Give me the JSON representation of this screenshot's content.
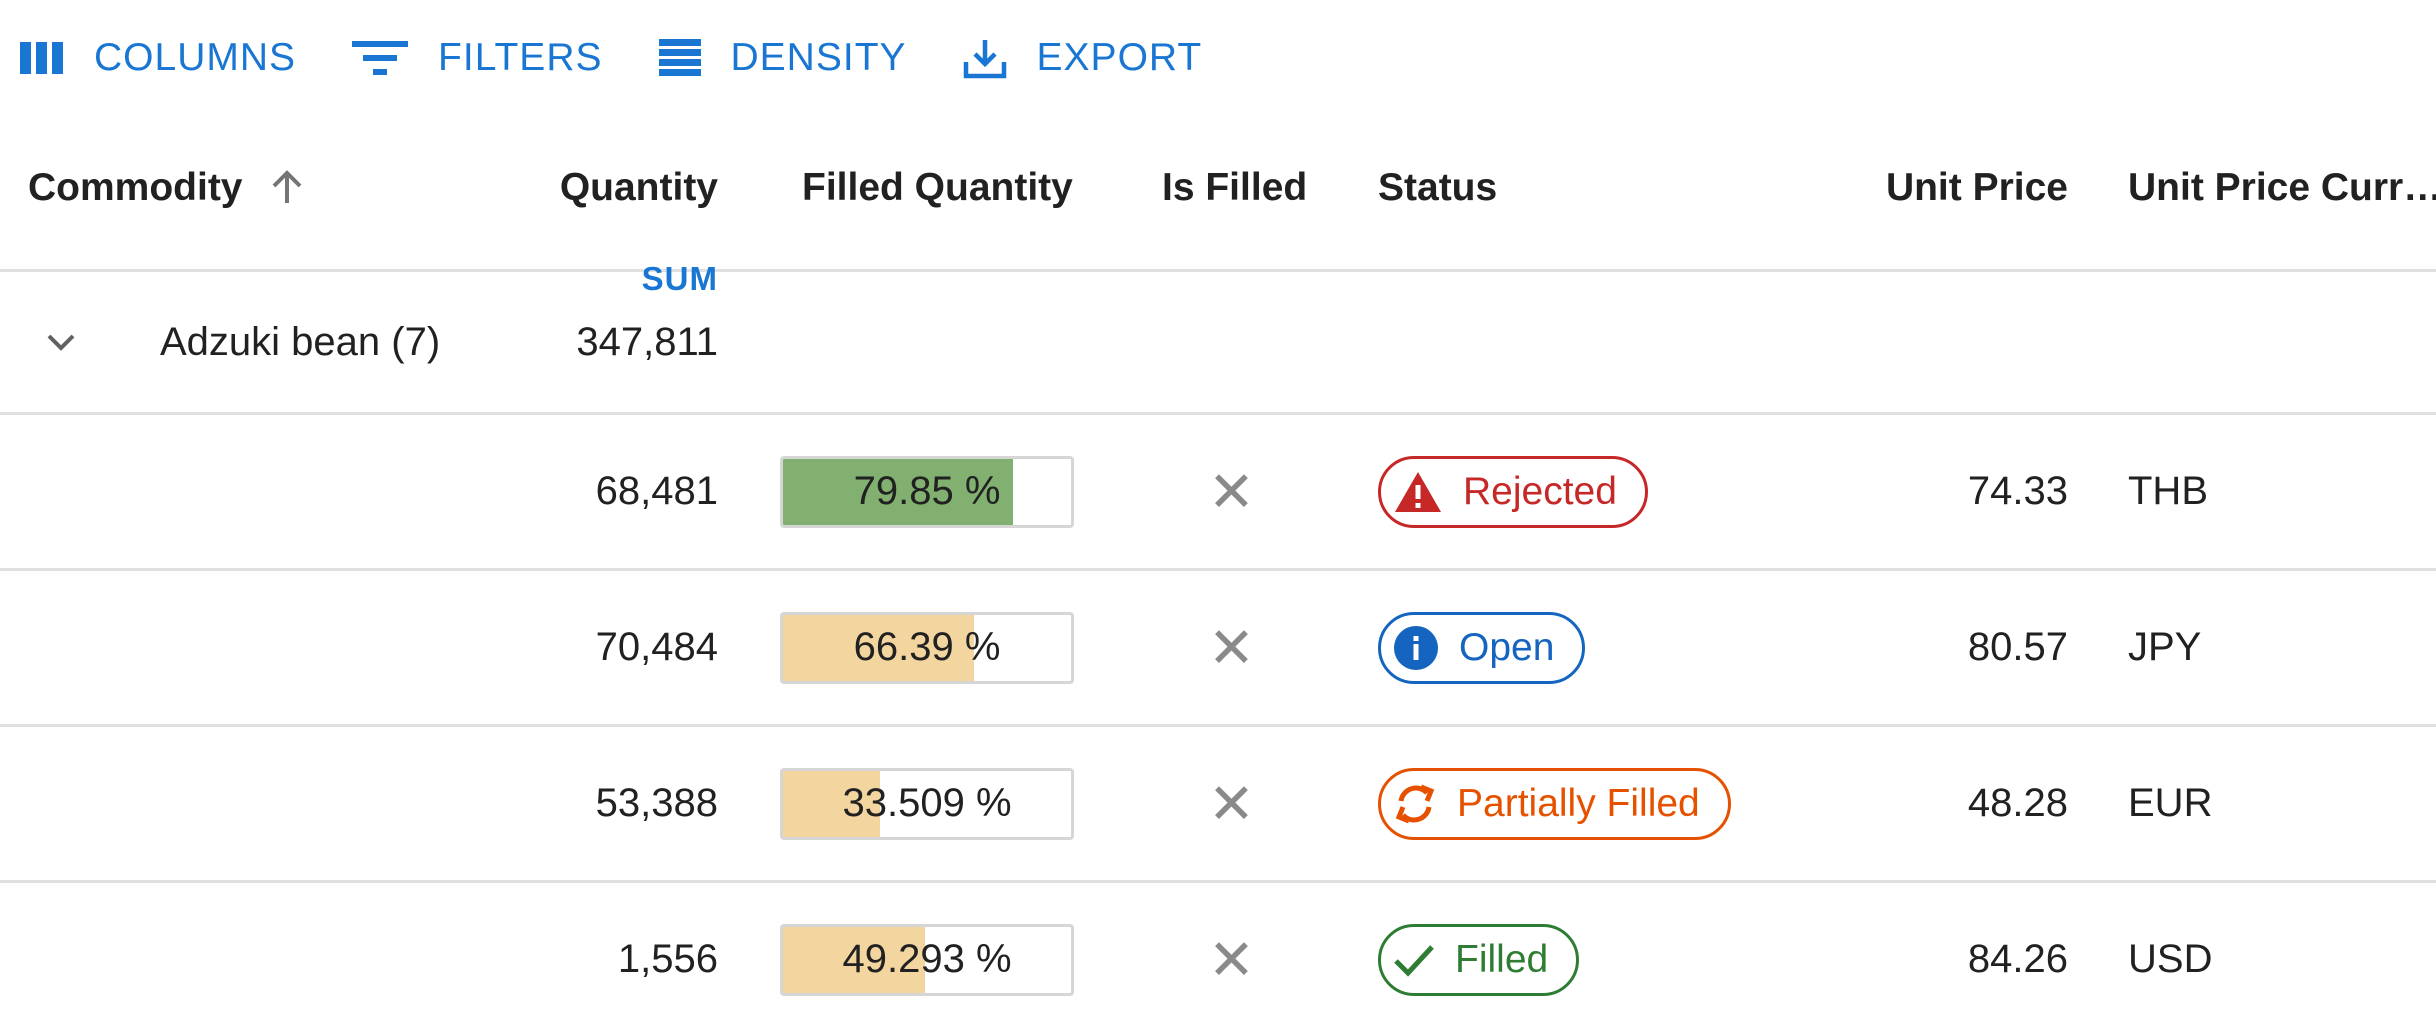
{
  "toolbar": {
    "columns_label": "COLUMNS",
    "filters_label": "FILTERS",
    "density_label": "DENSITY",
    "export_label": "EXPORT"
  },
  "columns": {
    "commodity": "Commodity",
    "quantity": "Quantity",
    "quantity_agg": "SUM",
    "filled_quantity": "Filled Quantity",
    "is_filled": "Is Filled",
    "status": "Status",
    "unit_price": "Unit Price",
    "unit_price_currency": "Unit Price Curr…"
  },
  "group": {
    "label": "Adzuki bean (7)",
    "quantity_sum": "347,811"
  },
  "rows": [
    {
      "quantity": "68,481",
      "filled_pct": 79.85,
      "filled_text": "79.85 %",
      "is_filled": "✕",
      "status": "Rejected",
      "unit_price": "74.33",
      "currency": "THB"
    },
    {
      "quantity": "70,484",
      "filled_pct": 66.39,
      "filled_text": "66.39 %",
      "is_filled": "✕",
      "status": "Open",
      "unit_price": "80.57",
      "currency": "JPY"
    },
    {
      "quantity": "53,388",
      "filled_pct": 33.509,
      "filled_text": "33.509 %",
      "is_filled": "✕",
      "status": "Partially Filled",
      "unit_price": "48.28",
      "currency": "EUR"
    },
    {
      "quantity": "1,556",
      "filled_pct": 49.293,
      "filled_text": "49.293 %",
      "is_filled": "✕",
      "status": "Filled",
      "unit_price": "84.26",
      "currency": "USD"
    }
  ],
  "colors": {
    "accent": "#1976d2",
    "progress_high": "#81b071",
    "progress_mid": "#f3d59f",
    "rejected": "#c62828",
    "open": "#1565c0",
    "partial": "#e65100",
    "filled": "#2e7d32"
  },
  "icons": {
    "columns": "columns-icon",
    "filters": "filter-icon",
    "density": "density-icon",
    "export": "export-icon",
    "sort": "arrow-up-icon",
    "expand": "chevron-down-icon",
    "rejected": "warning-icon",
    "open": "info-icon",
    "partial": "sync-icon",
    "filled": "check-icon",
    "not_filled": "close-icon"
  }
}
